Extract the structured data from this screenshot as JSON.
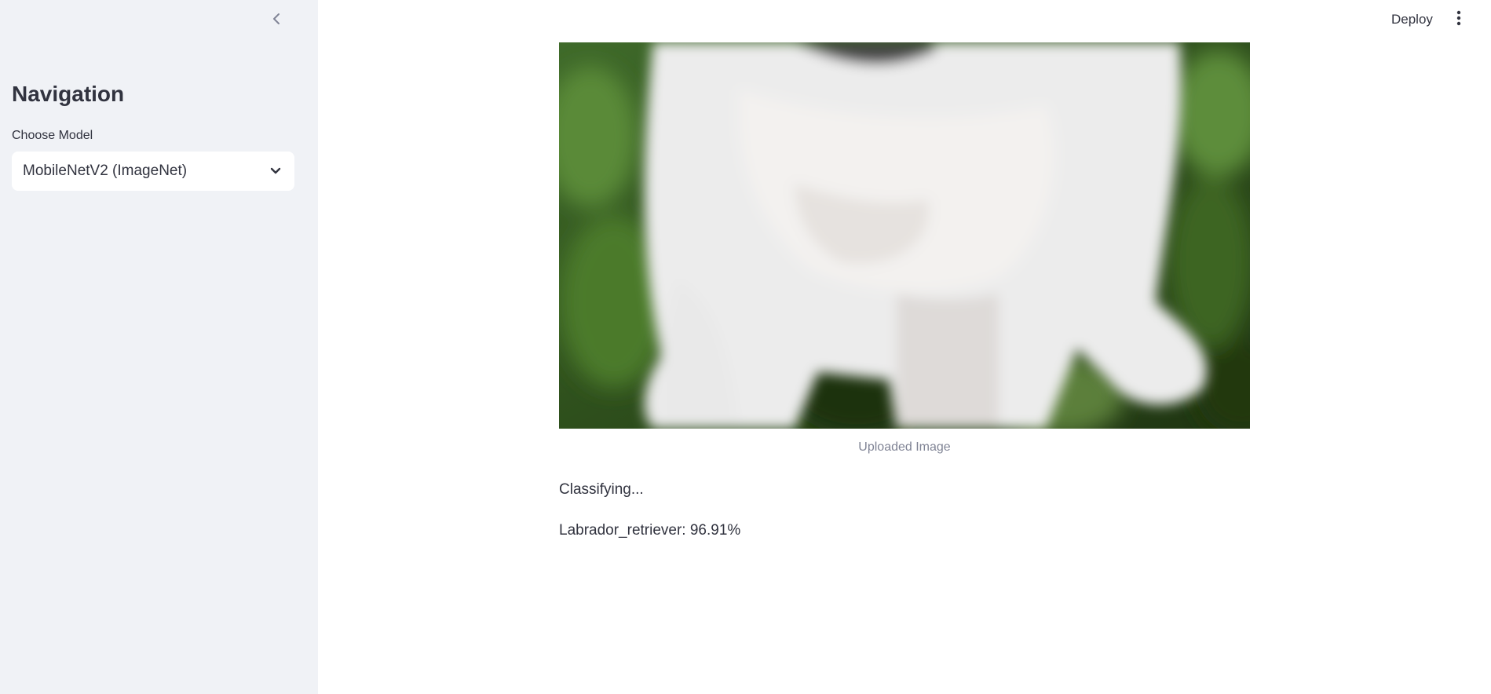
{
  "sidebar": {
    "title": "Navigation",
    "model_select": {
      "label": "Choose Model",
      "value": "MobileNetV2 (ImageNet)"
    },
    "collapse_icon": "chevron-left-icon"
  },
  "header": {
    "deploy_label": "Deploy",
    "menu_icon": "more-vertical-icon"
  },
  "main": {
    "image_caption": "Uploaded Image",
    "status": "Classifying...",
    "prediction": "Labrador_retriever: 96.91%"
  },
  "colors": {
    "sidebar_bg": "#f0f2f6",
    "text": "#31333f",
    "caption": "#808495"
  }
}
